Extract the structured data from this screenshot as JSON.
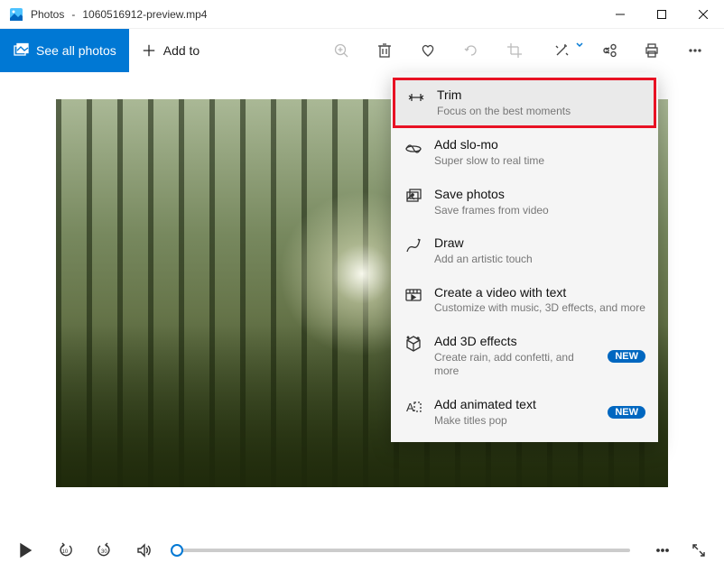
{
  "window": {
    "app_name": "Photos",
    "file_name": "1060516912-preview.mp4"
  },
  "commandbar": {
    "see_all_label": "See all photos",
    "add_to_label": "Add to"
  },
  "menu": {
    "items": [
      {
        "title": "Trim",
        "subtitle": "Focus on the best moments",
        "badge": null,
        "highlight": true,
        "icon": "trim-icon"
      },
      {
        "title": "Add slo-mo",
        "subtitle": "Super slow to real time",
        "badge": null,
        "highlight": false,
        "icon": "slomo-icon"
      },
      {
        "title": "Save photos",
        "subtitle": "Save frames from video",
        "badge": null,
        "highlight": false,
        "icon": "save-photos-icon"
      },
      {
        "title": "Draw",
        "subtitle": "Add an artistic touch",
        "badge": null,
        "highlight": false,
        "icon": "draw-icon"
      },
      {
        "title": "Create a video with text",
        "subtitle": "Customize with music, 3D effects, and more",
        "badge": null,
        "highlight": false,
        "icon": "create-video-icon"
      },
      {
        "title": "Add 3D effects",
        "subtitle": "Create rain, add confetti, and more",
        "badge": "NEW",
        "highlight": false,
        "icon": "3d-effects-icon"
      },
      {
        "title": "Add animated text",
        "subtitle": "Make titles pop",
        "badge": "NEW",
        "highlight": false,
        "icon": "animated-text-icon"
      }
    ]
  },
  "playback": {
    "position": 0
  }
}
